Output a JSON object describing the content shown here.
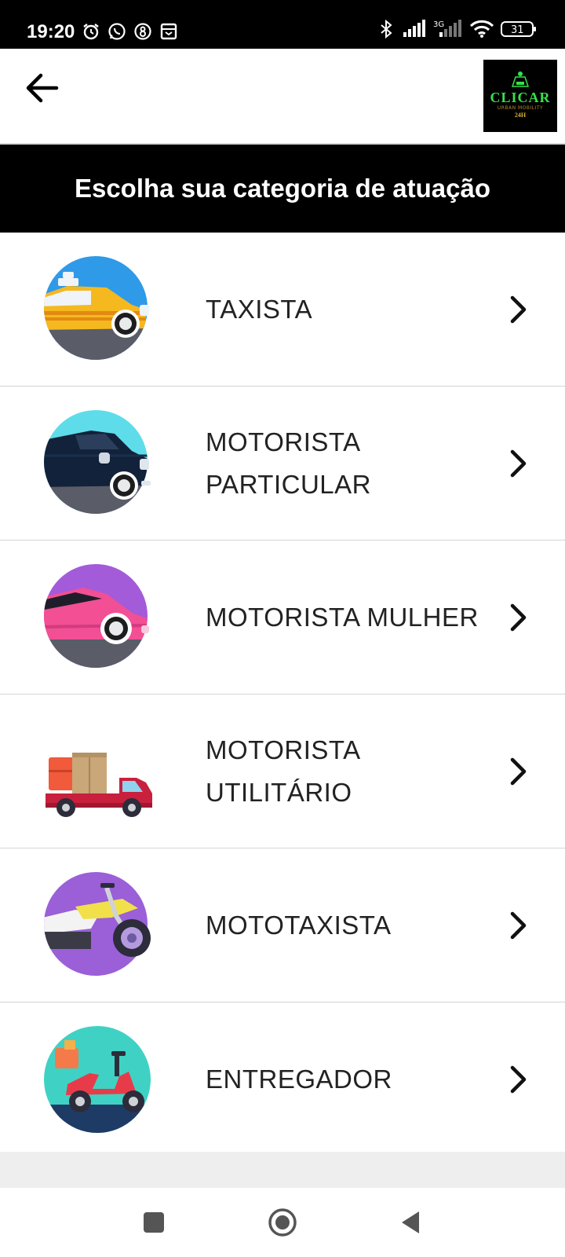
{
  "status_bar": {
    "time": "19:20",
    "battery": "31",
    "left_icons": [
      "alarm-icon",
      "whatsapp-icon",
      "app-8-icon",
      "calendar-icon"
    ],
    "right_icons": [
      "bluetooth-icon",
      "signal-icon",
      "signal-3g-icon",
      "wifi-icon",
      "battery-icon"
    ],
    "network_label": "3G"
  },
  "header": {
    "back_icon": "arrow-left-icon",
    "logo": {
      "text": "CLICAR",
      "sub": "URBAN MOBILITY",
      "badge": "24H"
    }
  },
  "title": "Escolha sua categoria de atuação",
  "categories": [
    {
      "label": "TAXISTA",
      "icon": "taxi-car-icon"
    },
    {
      "label": "MOTORISTA PARTICULAR",
      "icon": "private-car-icon"
    },
    {
      "label": "MOTORISTA MULHER",
      "icon": "pink-car-icon"
    },
    {
      "label": "MOTORISTA UTILITÁRIO",
      "icon": "utility-truck-icon"
    },
    {
      "label": "MOTOTAXISTA",
      "icon": "motorcycle-icon"
    },
    {
      "label": "ENTREGADOR",
      "icon": "delivery-scooter-icon"
    }
  ],
  "nav": {
    "icons": [
      "recents-square-icon",
      "home-circle-icon",
      "back-triangle-icon"
    ]
  },
  "colors": {
    "title_band": "#000000",
    "logo_green": "#34e24a",
    "divider": "#d4d4d4"
  }
}
